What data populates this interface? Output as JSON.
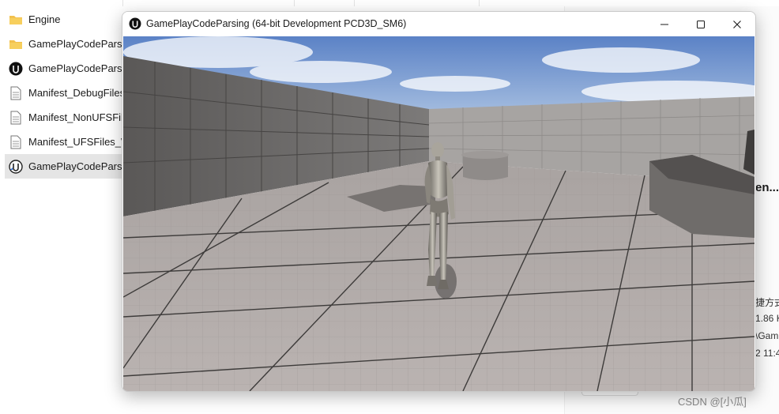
{
  "explorer": {
    "files": [
      {
        "name": "Engine",
        "icon": "folder-icon"
      },
      {
        "name": "GamePlayCodeParsing",
        "icon": "folder-icon"
      },
      {
        "name": "GamePlayCodeParsing",
        "icon": "unreal-icon"
      },
      {
        "name": "Manifest_DebugFiles_",
        "icon": "document-icon"
      },
      {
        "name": "Manifest_NonUFSFiles",
        "icon": "document-icon"
      },
      {
        "name": "Manifest_UFSFiles_Wir",
        "icon": "document-icon"
      },
      {
        "name": "GamePlayCodeParsing",
        "icon": "unreal-exe-icon",
        "selected": true
      }
    ],
    "details": {
      "name": "en...",
      "type": "捷方式",
      "size": "1.86 K",
      "path": "\\Gam.",
      "date": "2 11:4"
    },
    "watermark": "CSDN @[小瓜]"
  },
  "game_window": {
    "title": "GamePlayCodeParsing (64-bit Development PCD3D_SM6)",
    "controls": [
      "minimize-icon",
      "maximize-icon",
      "close-icon"
    ],
    "colors": {
      "sky_top": "#5b82c6",
      "sky_bottom": "#bcd0e8",
      "floor": "#b3acaa",
      "wall": "#8b8886"
    }
  }
}
